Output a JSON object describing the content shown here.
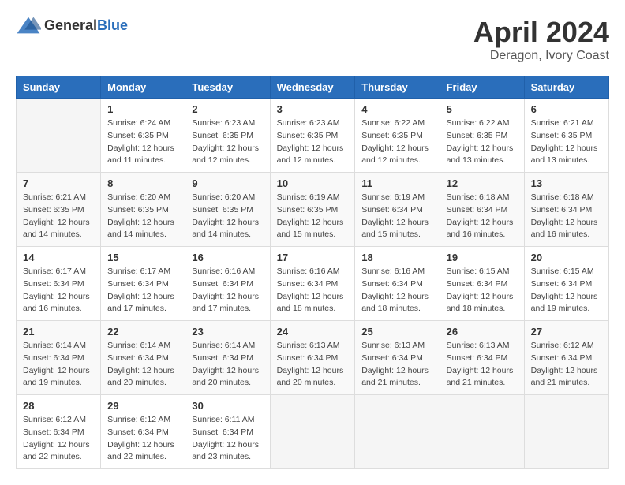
{
  "header": {
    "logo_general": "General",
    "logo_blue": "Blue",
    "title": "April 2024",
    "location": "Deragon, Ivory Coast"
  },
  "calendar": {
    "days_of_week": [
      "Sunday",
      "Monday",
      "Tuesday",
      "Wednesday",
      "Thursday",
      "Friday",
      "Saturday"
    ],
    "weeks": [
      [
        {
          "day": "",
          "info": ""
        },
        {
          "day": "1",
          "info": "Sunrise: 6:24 AM\nSunset: 6:35 PM\nDaylight: 12 hours\nand 11 minutes."
        },
        {
          "day": "2",
          "info": "Sunrise: 6:23 AM\nSunset: 6:35 PM\nDaylight: 12 hours\nand 12 minutes."
        },
        {
          "day": "3",
          "info": "Sunrise: 6:23 AM\nSunset: 6:35 PM\nDaylight: 12 hours\nand 12 minutes."
        },
        {
          "day": "4",
          "info": "Sunrise: 6:22 AM\nSunset: 6:35 PM\nDaylight: 12 hours\nand 12 minutes."
        },
        {
          "day": "5",
          "info": "Sunrise: 6:22 AM\nSunset: 6:35 PM\nDaylight: 12 hours\nand 13 minutes."
        },
        {
          "day": "6",
          "info": "Sunrise: 6:21 AM\nSunset: 6:35 PM\nDaylight: 12 hours\nand 13 minutes."
        }
      ],
      [
        {
          "day": "7",
          "info": "Sunrise: 6:21 AM\nSunset: 6:35 PM\nDaylight: 12 hours\nand 14 minutes."
        },
        {
          "day": "8",
          "info": "Sunrise: 6:20 AM\nSunset: 6:35 PM\nDaylight: 12 hours\nand 14 minutes."
        },
        {
          "day": "9",
          "info": "Sunrise: 6:20 AM\nSunset: 6:35 PM\nDaylight: 12 hours\nand 14 minutes."
        },
        {
          "day": "10",
          "info": "Sunrise: 6:19 AM\nSunset: 6:35 PM\nDaylight: 12 hours\nand 15 minutes."
        },
        {
          "day": "11",
          "info": "Sunrise: 6:19 AM\nSunset: 6:34 PM\nDaylight: 12 hours\nand 15 minutes."
        },
        {
          "day": "12",
          "info": "Sunrise: 6:18 AM\nSunset: 6:34 PM\nDaylight: 12 hours\nand 16 minutes."
        },
        {
          "day": "13",
          "info": "Sunrise: 6:18 AM\nSunset: 6:34 PM\nDaylight: 12 hours\nand 16 minutes."
        }
      ],
      [
        {
          "day": "14",
          "info": "Sunrise: 6:17 AM\nSunset: 6:34 PM\nDaylight: 12 hours\nand 16 minutes."
        },
        {
          "day": "15",
          "info": "Sunrise: 6:17 AM\nSunset: 6:34 PM\nDaylight: 12 hours\nand 17 minutes."
        },
        {
          "day": "16",
          "info": "Sunrise: 6:16 AM\nSunset: 6:34 PM\nDaylight: 12 hours\nand 17 minutes."
        },
        {
          "day": "17",
          "info": "Sunrise: 6:16 AM\nSunset: 6:34 PM\nDaylight: 12 hours\nand 18 minutes."
        },
        {
          "day": "18",
          "info": "Sunrise: 6:16 AM\nSunset: 6:34 PM\nDaylight: 12 hours\nand 18 minutes."
        },
        {
          "day": "19",
          "info": "Sunrise: 6:15 AM\nSunset: 6:34 PM\nDaylight: 12 hours\nand 18 minutes."
        },
        {
          "day": "20",
          "info": "Sunrise: 6:15 AM\nSunset: 6:34 PM\nDaylight: 12 hours\nand 19 minutes."
        }
      ],
      [
        {
          "day": "21",
          "info": "Sunrise: 6:14 AM\nSunset: 6:34 PM\nDaylight: 12 hours\nand 19 minutes."
        },
        {
          "day": "22",
          "info": "Sunrise: 6:14 AM\nSunset: 6:34 PM\nDaylight: 12 hours\nand 20 minutes."
        },
        {
          "day": "23",
          "info": "Sunrise: 6:14 AM\nSunset: 6:34 PM\nDaylight: 12 hours\nand 20 minutes."
        },
        {
          "day": "24",
          "info": "Sunrise: 6:13 AM\nSunset: 6:34 PM\nDaylight: 12 hours\nand 20 minutes."
        },
        {
          "day": "25",
          "info": "Sunrise: 6:13 AM\nSunset: 6:34 PM\nDaylight: 12 hours\nand 21 minutes."
        },
        {
          "day": "26",
          "info": "Sunrise: 6:13 AM\nSunset: 6:34 PM\nDaylight: 12 hours\nand 21 minutes."
        },
        {
          "day": "27",
          "info": "Sunrise: 6:12 AM\nSunset: 6:34 PM\nDaylight: 12 hours\nand 21 minutes."
        }
      ],
      [
        {
          "day": "28",
          "info": "Sunrise: 6:12 AM\nSunset: 6:34 PM\nDaylight: 12 hours\nand 22 minutes."
        },
        {
          "day": "29",
          "info": "Sunrise: 6:12 AM\nSunset: 6:34 PM\nDaylight: 12 hours\nand 22 minutes."
        },
        {
          "day": "30",
          "info": "Sunrise: 6:11 AM\nSunset: 6:34 PM\nDaylight: 12 hours\nand 23 minutes."
        },
        {
          "day": "",
          "info": ""
        },
        {
          "day": "",
          "info": ""
        },
        {
          "day": "",
          "info": ""
        },
        {
          "day": "",
          "info": ""
        }
      ]
    ]
  }
}
